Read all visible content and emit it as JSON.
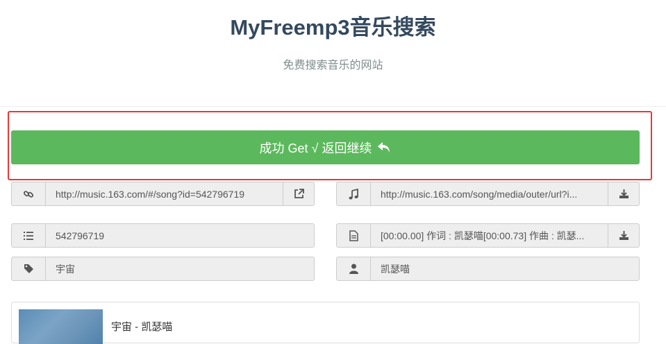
{
  "header": {
    "title": "MyFreemp3音乐搜索",
    "subtitle": "免费搜索音乐的网站"
  },
  "result": {
    "success_label": "成功 Get √ 返回继续"
  },
  "fields": {
    "song_link": "http://music.163.com/#/song?id=542796719",
    "audio_url": "http://music.163.com/song/media/outer/url?i...",
    "song_id": "542796719",
    "lyrics": "[00:00.00] 作词 : 凯瑟喵[00:00.73] 作曲 : 凯瑟...",
    "song_name": "宇宙",
    "artist": "凯瑟喵"
  },
  "card": {
    "title": "宇宙 - 凯瑟喵"
  },
  "colors": {
    "accent_green": "#5cb85c",
    "highlight_red": "#e53935",
    "title_color": "#34495e"
  }
}
